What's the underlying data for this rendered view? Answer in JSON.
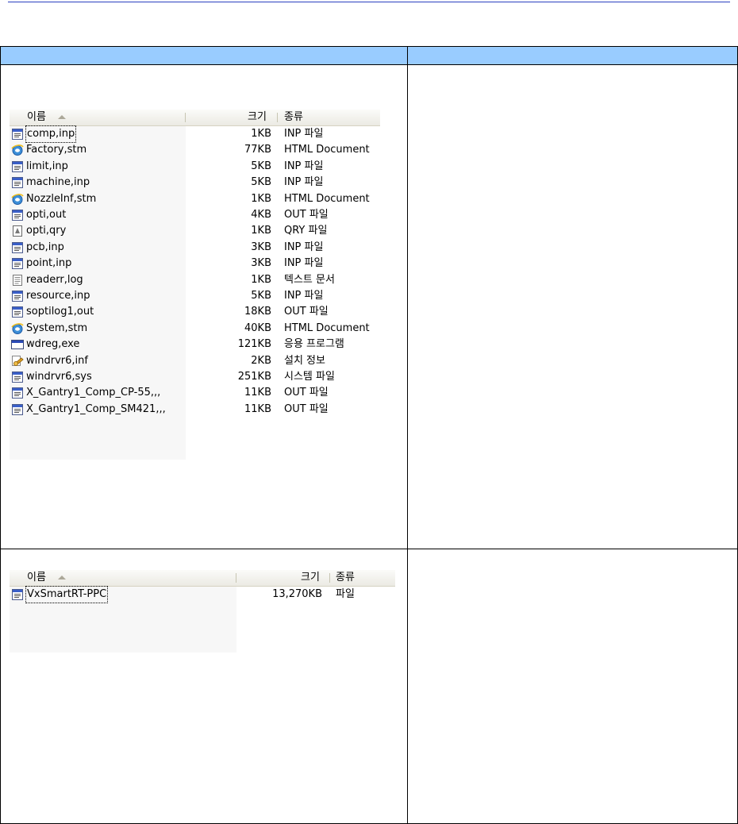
{
  "explorer1": {
    "columns": {
      "name": "이름",
      "size": "크기",
      "type": "종류"
    },
    "files": [
      {
        "name": "comp,inp",
        "size": "1KB",
        "type": "INP 파일",
        "icon": "inp-file-icon",
        "focused": true
      },
      {
        "name": "Factory,stm",
        "size": "77KB",
        "type": "HTML Document",
        "icon": "ie-document-icon"
      },
      {
        "name": "limit,inp",
        "size": "5KB",
        "type": "INP 파일",
        "icon": "inp-file-icon"
      },
      {
        "name": "machine,inp",
        "size": "5KB",
        "type": "INP 파일",
        "icon": "inp-file-icon"
      },
      {
        "name": "NozzleInf,stm",
        "size": "1KB",
        "type": "HTML Document",
        "icon": "ie-document-icon"
      },
      {
        "name": "opti,out",
        "size": "4KB",
        "type": "OUT 파일",
        "icon": "inp-file-icon"
      },
      {
        "name": "opti,qry",
        "size": "1KB",
        "type": "QRY 파일",
        "icon": "qry-file-icon"
      },
      {
        "name": "pcb,inp",
        "size": "3KB",
        "type": "INP 파일",
        "icon": "inp-file-icon"
      },
      {
        "name": "point,inp",
        "size": "3KB",
        "type": "INP 파일",
        "icon": "inp-file-icon"
      },
      {
        "name": "readerr,log",
        "size": "1KB",
        "type": "텍스트 문서",
        "icon": "text-document-icon"
      },
      {
        "name": "resource,inp",
        "size": "5KB",
        "type": "INP 파일",
        "icon": "inp-file-icon"
      },
      {
        "name": "soptilog1,out",
        "size": "18KB",
        "type": "OUT 파일",
        "icon": "inp-file-icon"
      },
      {
        "name": "System,stm",
        "size": "40KB",
        "type": "HTML Document",
        "icon": "ie-document-icon"
      },
      {
        "name": "wdreg,exe",
        "size": "121KB",
        "type": "응용 프로그램",
        "icon": "application-icon"
      },
      {
        "name": "windrvr6,inf",
        "size": "2KB",
        "type": "설치 정보",
        "icon": "setup-info-icon"
      },
      {
        "name": "windrvr6,sys",
        "size": "251KB",
        "type": "시스템 파일",
        "icon": "inp-file-icon"
      },
      {
        "name": "X_Gantry1_Comp_CP-55,,,",
        "size": "11KB",
        "type": "OUT 파일",
        "icon": "inp-file-icon"
      },
      {
        "name": "X_Gantry1_Comp_SM421,,,",
        "size": "11KB",
        "type": "OUT 파일",
        "icon": "inp-file-icon"
      }
    ]
  },
  "explorer2": {
    "columns": {
      "name": "이름",
      "size": "크기",
      "type": "종류"
    },
    "files": [
      {
        "name": "VxSmartRT-PPC",
        "size": "13,270KB",
        "type": "파일",
        "icon": "inp-file-icon",
        "focused": true
      }
    ]
  },
  "colors": {
    "header_fill": "#99ccff",
    "top_rule": "#2a3fbf"
  }
}
